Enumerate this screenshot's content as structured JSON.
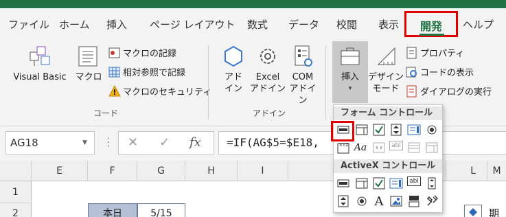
{
  "tabs": [
    {
      "label": "ファイル"
    },
    {
      "label": "ホーム"
    },
    {
      "label": "挿入"
    },
    {
      "label": "ページ レイアウト"
    },
    {
      "label": "数式"
    },
    {
      "label": "データ"
    },
    {
      "label": "校閲"
    },
    {
      "label": "表示"
    },
    {
      "label": "開発"
    },
    {
      "label": "ヘルプ"
    }
  ],
  "ribbon": {
    "code_group": {
      "label": "コード",
      "visual_basic": "Visual Basic",
      "macro": "マクロ",
      "record_macro": "マクロの記録",
      "relative_ref": "相対参照で記録",
      "macro_security": "マクロのセキュリティ"
    },
    "addin_group": {
      "label": "アドイン",
      "addin_1": "アド",
      "addin_2": "イン",
      "excel_addin_1": "Excel",
      "excel_addin_2": "アドイン",
      "com_addin_1": "COM",
      "com_addin_2": "アドイン"
    },
    "controls_group": {
      "insert": "挿入",
      "design_1": "デザイン",
      "design_2": "モード",
      "properties": "プロパティ",
      "view_code": "コードの表示",
      "run_dialog": "ダイアログの実行"
    }
  },
  "formula_bar": {
    "name_box": "AG18",
    "cancel": "✕",
    "enter": "✓",
    "fx": "fx",
    "formula": "=IF(AG$5=$E18,"
  },
  "grid": {
    "columns": [
      "E",
      "F",
      "G",
      "H",
      "I",
      "L",
      "M"
    ],
    "rows": [
      "1",
      "2"
    ],
    "cells": {
      "f2": "本日",
      "g2": "5/15",
      "m2": "期"
    }
  },
  "dropdown": {
    "form_controls": "フォーム コントロール",
    "activex_controls": "ActiveX コントロール"
  },
  "colors": {
    "accent": "#217346",
    "highlight": "#e00000"
  }
}
